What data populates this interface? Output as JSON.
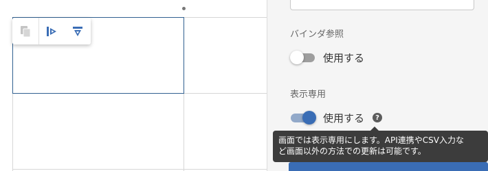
{
  "canvas": {
    "toolbar": {
      "icons": [
        "copy-icon",
        "insert-column-right-icon",
        "insert-row-below-icon"
      ],
      "colors": {
        "copy_icon": "#c4c4c4",
        "action_icon": "#3a6db5"
      }
    }
  },
  "panel": {
    "binder_reference": {
      "label": "バインダ参照",
      "toggle_label": "使用する",
      "enabled": false
    },
    "display_only": {
      "label": "表示専用",
      "toggle_label": "使用する",
      "enabled": true,
      "help_glyph": "?"
    },
    "tooltip": {
      "line1": "画面では表示専用にします。API連携やCSV入力な",
      "line2": "ど画面以外の方法での更新は可能です。"
    },
    "colors": {
      "accent": "#3a6db5",
      "toggle_on_track": "#92a9c9",
      "toggle_off_track": "#9e9e9e",
      "tooltip_bg": "#3c3c3c"
    }
  }
}
